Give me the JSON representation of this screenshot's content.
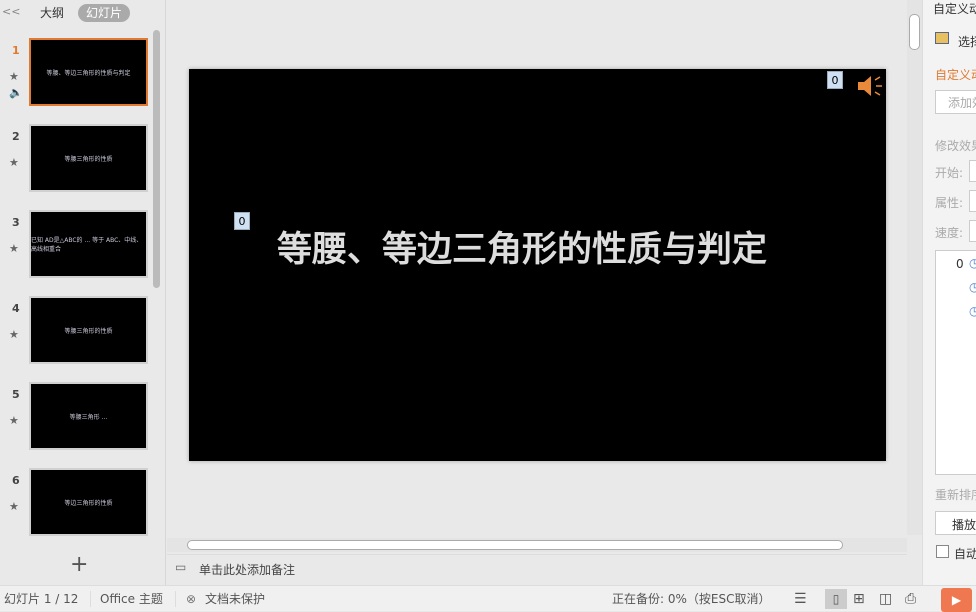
{
  "left_panel": {
    "collapse": "<<",
    "tabs": [
      "大纲",
      "幻灯片"
    ],
    "active_tab": 1,
    "add": "+",
    "slides": [
      {
        "num": "1",
        "text": "等腰、等边三角形的性质与判定",
        "selected": true,
        "sound": true
      },
      {
        "num": "2",
        "text": "等腰三角形的性质"
      },
      {
        "num": "3",
        "text": "已知 AD是△ABC的 ... 等于 ABC、中线、高线相重合"
      },
      {
        "num": "4",
        "text": "等腰三角形的性质"
      },
      {
        "num": "5",
        "text": "等腰三角形 ..."
      },
      {
        "num": "6",
        "text": "等边三角形的性质"
      }
    ]
  },
  "slide": {
    "title": "等腰、等边三角形的性质与判定",
    "badge_title": "0",
    "badge_audio": "0"
  },
  "notes": {
    "placeholder": "单击此处添加备注"
  },
  "right_panel": {
    "header": "自定义动画",
    "select_pane": "选择窗格",
    "section": "自定义动画",
    "add_effect": "添加效果",
    "modify": "修改效果",
    "start": "开始:",
    "property": "属性:",
    "speed": "速度:",
    "list_item": "0",
    "reorder": "重新排序",
    "play": "播放",
    "autopreview": "自动预览"
  },
  "status": {
    "slide": "幻灯片 1 / 12",
    "theme": "Office 主题",
    "protect": "文档未保护",
    "backup": "正在备份:   0%（按ESC取消）"
  },
  "colors": {
    "accent": "#e07a30",
    "play": "#f07850"
  }
}
